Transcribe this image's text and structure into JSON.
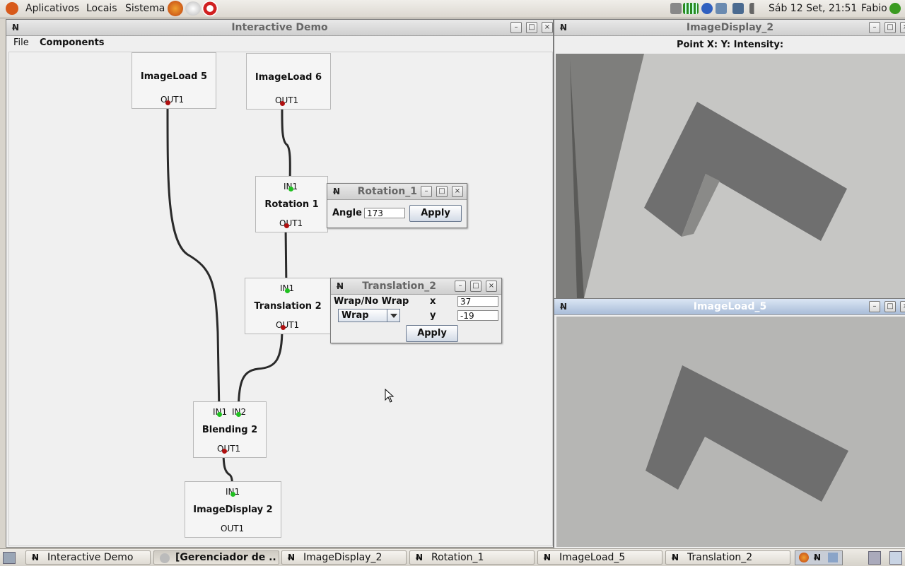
{
  "top_panel": {
    "menu": [
      "Aplicativos",
      "Locais",
      "Sistema"
    ],
    "datetime": "Sáb 12 Set, 21:51",
    "user": "Fabio"
  },
  "main_window": {
    "title": "Interactive Demo",
    "menubar": [
      "File",
      "Components"
    ],
    "nodes": {
      "imageload5": {
        "label": "ImageLoad 5",
        "out": "OUT1"
      },
      "imageload6": {
        "label": "ImageLoad 6",
        "out": "OUT1"
      },
      "rotation1": {
        "label": "Rotation 1",
        "in": "IN1",
        "out": "OUT1"
      },
      "translation2": {
        "label": "Translation 2",
        "in": "IN1",
        "out": "OUT1"
      },
      "blending2": {
        "label": "Blending 2",
        "in1": "IN1",
        "in2": "IN2",
        "out": "OUT1"
      },
      "imagedisplay2": {
        "label": "ImageDisplay 2",
        "in": "IN1",
        "out": "OUT1"
      }
    }
  },
  "rotation_dialog": {
    "title": "Rotation_1",
    "angle_label": "Angle",
    "angle_value": "173",
    "apply": "Apply"
  },
  "translation_dialog": {
    "title": "Translation_2",
    "wrap_label": "Wrap/No Wrap",
    "wrap_selected": "Wrap",
    "x_label": "x",
    "x_value": "37",
    "y_label": "y",
    "y_value": "-19",
    "apply": "Apply"
  },
  "display_window": {
    "title": "ImageDisplay_2",
    "info": "Point X:  Y:  Intensity:"
  },
  "imageload_window": {
    "title": "ImageLoad_5"
  },
  "taskbar": {
    "tasks": [
      "Interactive Demo",
      "[Gerenciador de ...",
      "ImageDisplay_2",
      "Rotation_1",
      "ImageLoad_5",
      "Translation_2"
    ]
  },
  "colors": {
    "output_port": "#b01010",
    "input_port": "#20c020",
    "active_title": "#a8bcd8"
  }
}
